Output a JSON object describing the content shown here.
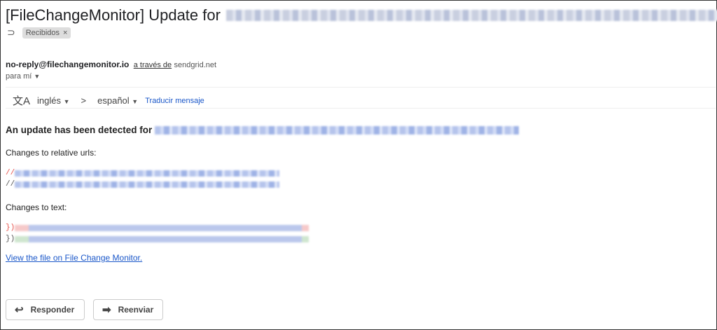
{
  "subject": {
    "prefix": "[FileChangeMonitor] Update for"
  },
  "labels": [
    {
      "name": "Recibidos",
      "close": "×"
    }
  ],
  "sender": {
    "email": "no-reply@filechangemonitor.io",
    "via": "a través de",
    "domain": "sendgrid.net",
    "to": "para mí"
  },
  "translate": {
    "from": "inglés",
    "arrow": ">",
    "to": "español",
    "action": "Traducir mensaje"
  },
  "body": {
    "heading": "An update has been detected for",
    "relative_urls_label": "Changes to relative urls:",
    "url_prefix_removed": "//",
    "url_prefix_added": "//",
    "text_label": "Changes to text:",
    "text_prefix_removed": "})",
    "text_prefix_added": "})",
    "view_link": "View the file on File Change Monitor."
  },
  "actions": {
    "reply": "Responder",
    "forward": "Reenviar"
  },
  "colors": {
    "link": "#1a57c9",
    "removed": "#e8524a"
  }
}
